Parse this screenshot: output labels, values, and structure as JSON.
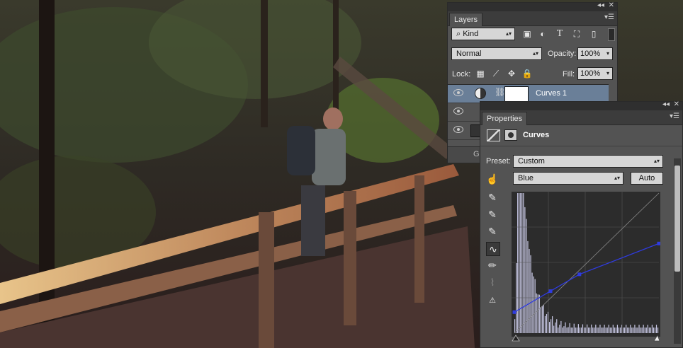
{
  "layers_panel": {
    "collapse_icon": "collapse-arrows",
    "close_icon": "x",
    "tab": "Layers",
    "filter_kind": "Kind",
    "blend_mode": "Normal",
    "opacity_label": "Opacity:",
    "opacity_value": "100%",
    "lock_label": "Lock:",
    "fill_label": "Fill:",
    "fill_value": "100%",
    "layers": [
      {
        "name": "Curves 1",
        "selected": true
      },
      {
        "name": "",
        "selected": false
      },
      {
        "name": "",
        "selected": false
      }
    ],
    "bottom_text": "G"
  },
  "properties_panel": {
    "tab": "Properties",
    "title": "Curves",
    "preset_label": "Preset:",
    "preset_value": "Custom",
    "channel_value": "Blue",
    "auto_label": "Auto",
    "curve_points": [
      [
        0,
        0.15
      ],
      [
        0.25,
        0.3
      ],
      [
        0.45,
        0.42
      ],
      [
        1,
        0.64
      ]
    ],
    "curve_color": "#2f3be0"
  },
  "colors": {
    "panel_bg": "#535353",
    "selected_row": "#6a7f98"
  }
}
